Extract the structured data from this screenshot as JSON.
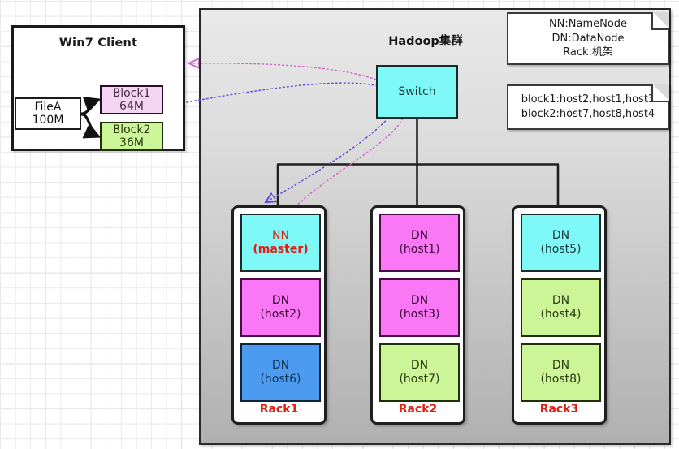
{
  "client": {
    "title": "Win7 Client",
    "file": {
      "name": "FileA",
      "size": "100M"
    },
    "blocks": [
      {
        "name": "Block1",
        "size": "64M",
        "color": "#f6d5f2"
      },
      {
        "name": "Block2",
        "size": "36M",
        "color": "#ccf598"
      }
    ]
  },
  "cluster": {
    "title": "Hadoop集群",
    "switch_label": "Switch",
    "notes": [
      {
        "lines": [
          "NN:NameNode",
          "DN:DataNode",
          "Rack:机架"
        ]
      },
      {
        "lines": [
          "block1:host2,host1,host3",
          "block2:host7,host8,host4"
        ]
      }
    ],
    "racks": [
      {
        "label": "Rack1",
        "nodes": [
          {
            "type": "NN",
            "host": "(master)",
            "color": "cyan",
            "highlight": true
          },
          {
            "type": "DN",
            "host": "(host2)",
            "color": "pink",
            "highlight": false
          },
          {
            "type": "DN",
            "host": "(host6)",
            "color": "blue",
            "highlight": false
          }
        ]
      },
      {
        "label": "Rack2",
        "nodes": [
          {
            "type": "DN",
            "host": "(host1)",
            "color": "pink",
            "highlight": false
          },
          {
            "type": "DN",
            "host": "(host3)",
            "color": "pink",
            "highlight": false
          },
          {
            "type": "DN",
            "host": "(host7)",
            "color": "green",
            "highlight": false
          }
        ]
      },
      {
        "label": "Rack3",
        "nodes": [
          {
            "type": "DN",
            "host": "(host5)",
            "color": "cyan",
            "highlight": false
          },
          {
            "type": "DN",
            "host": "(host4)",
            "color": "green",
            "highlight": false
          },
          {
            "type": "DN",
            "host": "(host8)",
            "color": "green",
            "highlight": false
          }
        ]
      }
    ]
  },
  "colors": {
    "cyan": "#7ff8f8",
    "pink": "#fa77f5",
    "blue": "#4d9bf0",
    "green": "#ccf598",
    "accent_red": "#e01f13",
    "request_arrow": "#d164c8",
    "response_arrow": "#5a4fd6",
    "container_border": "#2a2a2a"
  }
}
